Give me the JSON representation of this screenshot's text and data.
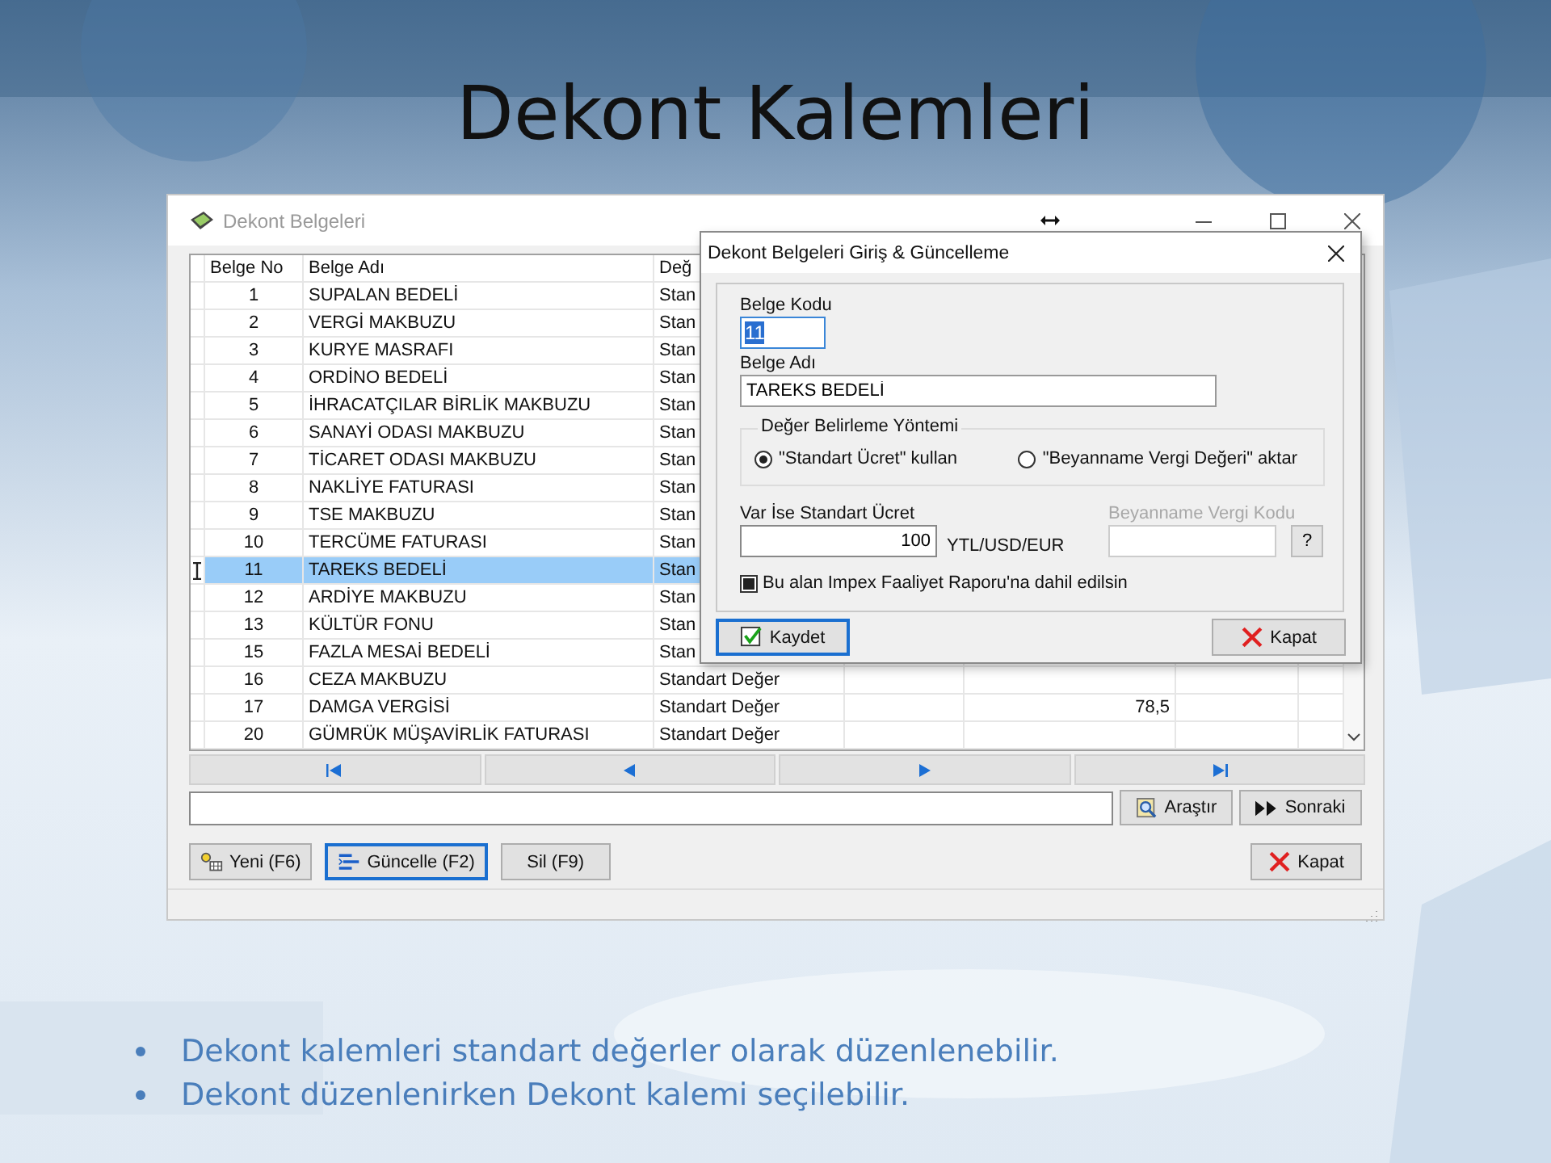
{
  "slide": {
    "title": "Dekont Kalemleri",
    "bullets": [
      "Dekont kalemleri standart değerler olarak düzenlenebilir.",
      "Dekont düzenlenirken Dekont kalemi seçilebilir."
    ]
  },
  "window": {
    "title": "Dekont Belgeleri",
    "table": {
      "columns": [
        "Belge No",
        "Belge Adı",
        "Değ"
      ],
      "rows": [
        {
          "no": "1",
          "name": "SUPALAN BEDELİ",
          "column_3": "Stan",
          "selected": false
        },
        {
          "no": "2",
          "name": "VERGİ MAKBUZU",
          "column_3": "Stan",
          "selected": false
        },
        {
          "no": "3",
          "name": "KURYE MASRAFI",
          "column_3": "Stan",
          "selected": false
        },
        {
          "no": "4",
          "name": "ORDİNO BEDELİ",
          "column_3": "Stan",
          "selected": false
        },
        {
          "no": "5",
          "name": "İHRACATÇILAR BİRLİK MAKBUZU",
          "column_3": "Stan",
          "selected": false
        },
        {
          "no": "6",
          "name": "SANAYİ ODASI MAKBUZU",
          "column_3": "Stan",
          "selected": false
        },
        {
          "no": "7",
          "name": "TİCARET ODASI MAKBUZU",
          "column_3": "Stan",
          "selected": false
        },
        {
          "no": "8",
          "name": "NAKLİYE FATURASI",
          "column_3": "Stan",
          "selected": false
        },
        {
          "no": "9",
          "name": "TSE MAKBUZU",
          "column_3": "Stan",
          "selected": false
        },
        {
          "no": "10",
          "name": "TERCÜME FATURASI",
          "column_3": "Stan",
          "selected": false
        },
        {
          "no": "11",
          "name": "TAREKS BEDELİ",
          "column_3": "Stan",
          "selected": true
        },
        {
          "no": "12",
          "name": "ARDİYE MAKBUZU",
          "column_3": "Stan",
          "selected": false
        },
        {
          "no": "13",
          "name": "KÜLTÜR FONU",
          "column_3": "Stan",
          "selected": false
        },
        {
          "no": "15",
          "name": "FAZLA MESAİ BEDELİ",
          "column_3": "Stan",
          "selected": false
        },
        {
          "no": "16",
          "name": "CEZA MAKBUZU",
          "column_3": "Standart Değer",
          "selected": false
        },
        {
          "no": "17",
          "name": "DAMGA VERGİSİ",
          "column_3": "Standart Değer",
          "column_5": "78,5",
          "selected": false
        },
        {
          "no": "20",
          "name": "GÜMRÜK MÜŞAVİRLİK FATURASI",
          "column_3": "Standart Değer",
          "selected": false
        }
      ]
    },
    "search": {
      "buttons": [
        "Araştır",
        "Sonraki"
      ]
    },
    "buttons": [
      {
        "label": "Yeni (F6)",
        "kind": "new",
        "focused": false
      },
      {
        "label": "Güncelle (F2)",
        "kind": "update",
        "focused": true
      },
      {
        "label": "Sil (F9)",
        "kind": "plain",
        "focused": false
      }
    ],
    "close_button": "Kapat"
  },
  "dialog": {
    "title": "Dekont Belgeleri Giriş & Güncelleme",
    "code": {
      "label": "Belge Kodu",
      "value": "11"
    },
    "name": {
      "label": "Belge Adı",
      "value": "TAREKS BEDELİ"
    },
    "method": {
      "label": "Değer Belirleme Yöntemi",
      "options": [
        {
          "label": "\"Standart Ücret\" kullan",
          "selected": true
        },
        {
          "label": "\"Beyanname Vergi Değeri\" aktar",
          "selected": false
        }
      ]
    },
    "fee": {
      "label": "Var  İse Standart Ücret",
      "value": "100",
      "unit": "YTL/USD/EUR"
    },
    "tax_code": {
      "label": "Beyanname Vergi Kodu",
      "disabled": true,
      "button": "?"
    },
    "report": {
      "label": "Bu alan Impex Faaliyet Raporu'na dahil edilsin",
      "checked": true
    },
    "save_button": {
      "label": "Kaydet",
      "focused": true
    },
    "close_button": "Kapat"
  }
}
